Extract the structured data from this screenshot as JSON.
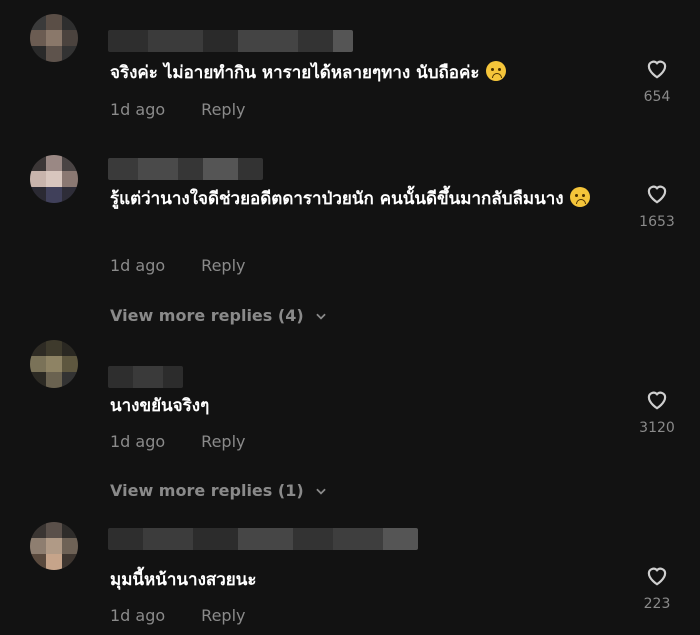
{
  "comments": [
    {
      "text": "จริงค่ะ ไม่อายทำกิน หารายได้หลายๆทาง นับถือค่ะ",
      "emoji": "pleading-face",
      "time": "1d ago",
      "reply_label": "Reply",
      "likes": "654",
      "view_more": null
    },
    {
      "text": "รู้แต่ว่านางใจดีช่วยอดีตดาราป่วยนัก คนนั้นดีขึ้นมากลับลืมนาง",
      "emoji": "pleading-face",
      "time": "1d ago",
      "reply_label": "Reply",
      "likes": "1653",
      "view_more": "View more replies (4)"
    },
    {
      "text": "นางขยันจริงๆ",
      "emoji": null,
      "time": "1d ago",
      "reply_label": "Reply",
      "likes": "3120",
      "view_more": "View more replies (1)"
    },
    {
      "text": "มุมนี้หน้านางสวยนะ",
      "emoji": null,
      "time": "1d ago",
      "reply_label": "Reply",
      "likes": "223",
      "view_more": null
    }
  ],
  "icons": {
    "like": "heart-outline-icon",
    "expand": "chevron-down-icon"
  },
  "colors": {
    "background": "#121212",
    "text": "#ffffff",
    "muted": "#8a8a8a"
  }
}
